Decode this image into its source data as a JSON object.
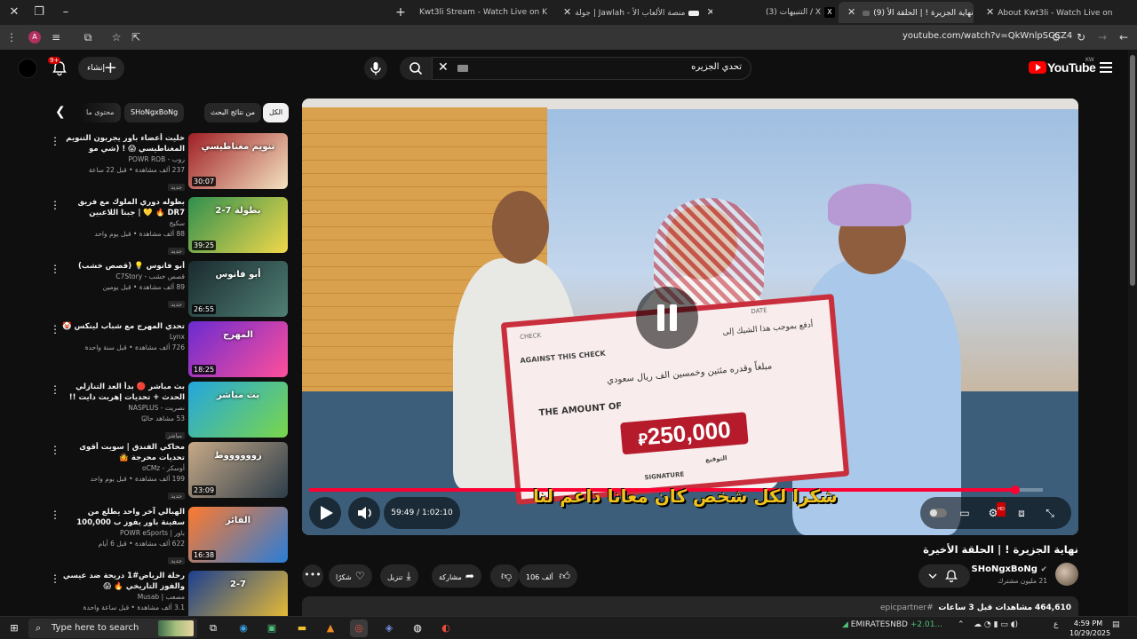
{
  "browser": {
    "tabs": [
      {
        "label": "Kwt3li Stream - Watch Live on K",
        "active": false
      },
      {
        "label": "جولة | Jawlah - منصة الألعاب الأ",
        "active": false
      },
      {
        "label": "(3) التنبيهات / X",
        "active": false
      },
      {
        "label": "(9) نهاية الجزيرة ! | الحلقة الأ",
        "active": true
      },
      {
        "label": "About Kwt3li - Watch Live on K",
        "active": false
      }
    ],
    "profile_initial": "A",
    "url": "youtube.com/watch?v=QkWnlpSCCZ4"
  },
  "yt_header": {
    "logo_text": "YouTube",
    "country": "KW",
    "search_query": "تحدي الجزيره",
    "create_label": "إنشاء",
    "notif_count": "9+"
  },
  "filter_chips": [
    "الكل",
    "من نتائج البحث",
    "SHoNgxBoNg",
    "محتوى ما"
  ],
  "recommendations": [
    {
      "title": "خليت أعضاء باور يجربون التنويم المغناطيسي 😱 ! (شي مو طبيعي!!)",
      "channel": "روب - POWR ROB",
      "views": "237 ألف مشاهدة • قبل 22 ساعة",
      "badge": "جديد",
      "duration": "30:07",
      "thumb_text": "تنويم مغناطيسي",
      "c1": "#a01f26",
      "c2": "#f3e3c0"
    },
    {
      "title": "بطوله دوري الملوك مع فريق DR7 🔥 💛 | جبنا اللاعبين دفايص 😂 🔥",
      "channel": "سكيج",
      "views": "88 ألف مشاهدة • قبل يوم واحد",
      "badge": "جديد",
      "duration": "39:25",
      "thumb_text": "2-7 بطولة",
      "c1": "#2f8f4f",
      "c2": "#f1d84a"
    },
    {
      "title": "أبو فانوس 💡 (قصص خشب)",
      "channel": "قصص خشب - C7Story",
      "views": "89 ألف مشاهدة • قبل يومين",
      "badge": "جديد",
      "duration": "26:55",
      "thumb_text": "أبو فانوس",
      "c1": "#1a2a2e",
      "c2": "#4f7f75"
    },
    {
      "title": "تحدي المهرج مع شباب لينكس 🤡",
      "channel": "Lynx",
      "views": "726 ألف مشاهدة • قبل سنة واحدة",
      "badge": "",
      "duration": "18:25",
      "thumb_text": "المهرج",
      "c1": "#6a2bd1",
      "c2": "#ff4f9a"
    },
    {
      "title": "بث مباشر 🔴 بدأ العد التنازلي الحدث + تحديات إهربت دايت !! #epicpartner",
      "channel": "نصريت - NASPLUS",
      "views": "53 مشاهد حاليًا",
      "badge": "مباشر",
      "duration": "",
      "thumb_text": "بث مباشر",
      "c1": "#23a6de",
      "c2": "#7bd64a"
    },
    {
      "title": "محاكي الفندق | سويت أقوى تحديات محرجة 🤷",
      "channel": "أوسكر - oCMz",
      "views": "199 ألف مشاهدة • قبل يوم واحد",
      "badge": "جديد",
      "duration": "23:09",
      "thumb_text": "زووووووط",
      "c1": "#c7a987",
      "c2": "#2d3d4a"
    },
    {
      "title": "الهبالي آخر واحد يطلع من سفينة باور يفوز ب 100,000 ريال #5",
      "channel": "باور | POWR eSports",
      "views": "622 ألف مشاهدة • قبل 6 أيام",
      "badge": "جديد",
      "duration": "16:38",
      "thumb_text": "الفائز",
      "c1": "#ff7a2d",
      "c2": "#2a7dd8"
    },
    {
      "title": "رحلة الرياض#1 دريحة ضد عيسي والفوز التاريخي 🔥 😱",
      "channel": "مصعب | Musab",
      "views": "3.1 ألف مشاهدة • قبل ساعة واحدة",
      "badge": "",
      "duration": "",
      "thumb_text": "2-7",
      "c1": "#1c3f8f",
      "c2": "#f2c230"
    }
  ],
  "player": {
    "time_current": "59:49",
    "time_total": "1:02:10",
    "time_display": "59:49 / 1:02:10",
    "progress_fraction": 0.962,
    "caption": "شكرا لكل شخص كان معانا داعم لنا",
    "hd_badge": "HD",
    "check": {
      "label_check": "CHECK",
      "label_date": "DATE",
      "against": "AGAINST THIS CHECK",
      "pay_line": "أدفع بموجب هذا الشيك إلى",
      "amount_label": "THE AMOUNT OF",
      "amount_words": "مبلغاً وقدره مئتين وخمسين الف ريال سعودي",
      "amount": "250,000",
      "signature": "SIGNATURE",
      "signature_ar": "التوقيع"
    }
  },
  "video": {
    "title": "نهاية الجزيرة ! | الحلقة الأخيرة",
    "channel": "SHoNgxBoNg",
    "subscribers": "21 مليون مشترك",
    "likes": "106 ألف",
    "share_label": "مشاركة",
    "download_label": "تنزيل",
    "thanks_label": "شكرًا",
    "views_line": "464,610 مشاهدات قبل 3 ساعات",
    "views_count": "464,610",
    "views_rest": "مشاهدات قبل 3 ساعات",
    "hashtag": "#epicpartner"
  },
  "taskbar": {
    "search_placeholder": "Type here to search",
    "stock_name": "EMIRATESNBD",
    "stock_change": "+2.01...",
    "lang": "ع",
    "time": "4:59 PM",
    "date": "10/29/2025"
  }
}
